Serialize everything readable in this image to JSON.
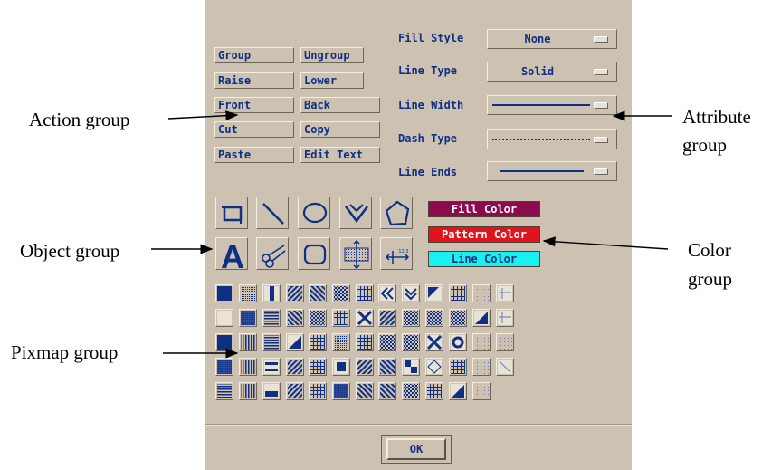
{
  "action_buttons": [
    {
      "label": "Group",
      "name": "group-button"
    },
    {
      "label": "Ungroup",
      "name": "ungroup-button"
    },
    {
      "label": "Raise",
      "name": "raise-button"
    },
    {
      "label": "Lower",
      "name": "lower-button"
    },
    {
      "label": "Front",
      "name": "front-button"
    },
    {
      "label": "Back",
      "name": "back-button"
    },
    {
      "label": "Cut",
      "name": "cut-button"
    },
    {
      "label": "Copy",
      "name": "copy-button"
    },
    {
      "label": "Paste",
      "name": "paste-button"
    },
    {
      "label": "Edit Text",
      "name": "edit-text-button"
    }
  ],
  "attributes": {
    "fill_style": {
      "label": "Fill Style",
      "value": "None"
    },
    "line_type": {
      "label": "Line Type",
      "value": "Solid"
    },
    "line_width": {
      "label": "Line Width"
    },
    "dash_type": {
      "label": "Dash Type"
    },
    "line_ends": {
      "label": "Line Ends"
    }
  },
  "object_tools": [
    {
      "name": "rectangle-tool-icon"
    },
    {
      "name": "line-tool-icon"
    },
    {
      "name": "ellipse-tool-icon"
    },
    {
      "name": "polyline-tool-icon"
    },
    {
      "name": "polygon-tool-icon"
    },
    {
      "name": "text-tool-icon",
      "glyph": "A"
    },
    {
      "name": "scissors-tool-icon"
    },
    {
      "name": "rounded-rectangle-tool-icon"
    },
    {
      "name": "pixmap-tool-icon"
    },
    {
      "name": "dimension-line-tool-icon",
      "tag": "12.3"
    }
  ],
  "color_buttons": [
    {
      "label": "Fill Color",
      "bg": "#8b0b4c",
      "fg": "#ffffff"
    },
    {
      "label": "Pattern Color",
      "bg": "#e0141c",
      "fg": "#ffffff"
    },
    {
      "label": "Line Color",
      "bg": "#19f1f1",
      "fg": "#0e2f84"
    }
  ],
  "pixmap_rows": [
    [
      "solid",
      "dots",
      "vbar",
      "diag",
      "bigdiag",
      "check",
      "xdiag",
      "chevl",
      "chevd",
      "corner",
      "grid",
      "dotdiag",
      "hbarl"
    ],
    [
      "empty",
      "dense",
      "hlines",
      "bdiag",
      "check2",
      "smallgrid",
      "bigx",
      "diag2",
      "check3",
      "xcheck",
      "bigcheck",
      "triangle",
      "hbarl"
    ],
    [
      "solid",
      "vlines",
      "hlines2",
      "halfdiag",
      "xhatch",
      "dotsgrid",
      "hash",
      "vcheck",
      "xcheck2",
      "boxx",
      "circle",
      "sparse",
      "wave"
    ],
    [
      "dense",
      "vlines2",
      "hbars",
      "diag3",
      "crosshatch",
      "square",
      "wavy",
      "waves2",
      "quarter",
      "diamond",
      "stars",
      "stipple",
      "slash"
    ],
    [
      "hlines3",
      "twobars",
      "bottombar",
      "diag4",
      "maze",
      "dense2",
      "diag5",
      "diag6",
      "checks4",
      "grid2",
      "halftri",
      "tinylines"
    ]
  ],
  "annotations": {
    "action": "Action group",
    "attribute_line1": "Attribute",
    "attribute_line2": "group",
    "object": "Object group",
    "color_line1": "Color",
    "color_line2": "group",
    "pixmap": "Pixmap group"
  },
  "ok_label": "OK",
  "colors": {
    "panel": "#cdc2b2",
    "text": "#0e2f84",
    "highlight": "#d0302b"
  }
}
